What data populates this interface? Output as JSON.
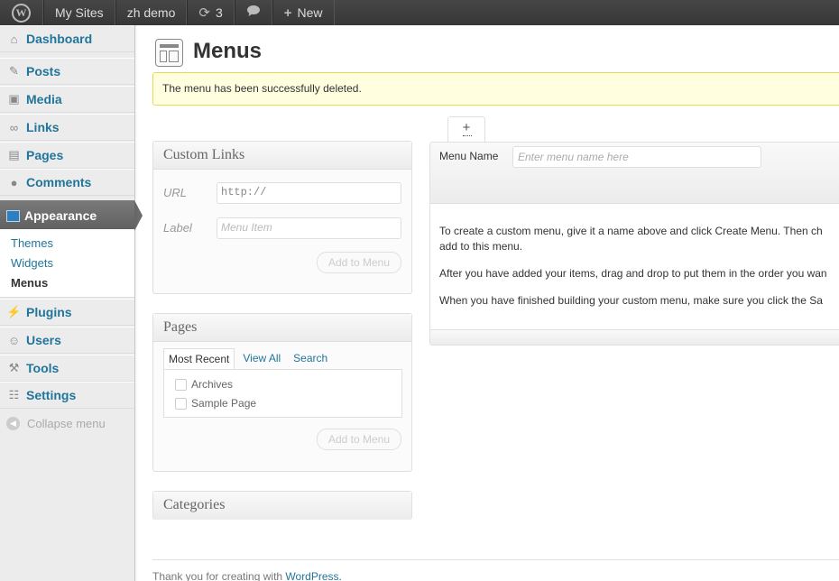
{
  "adminbar": {
    "wp_logo": "wordpress-icon",
    "items": [
      {
        "label": "My Sites"
      },
      {
        "label": "zh demo"
      },
      {
        "label": "3",
        "icon": "update-icon"
      },
      {
        "label": "",
        "icon": "comment-icon"
      },
      {
        "label": "New",
        "icon": "plus-icon"
      }
    ]
  },
  "sidebar": {
    "items": [
      {
        "label": "Dashboard",
        "icon": "home-icon"
      },
      {
        "label": "Posts",
        "icon": "pin-icon"
      },
      {
        "label": "Media",
        "icon": "media-icon"
      },
      {
        "label": "Links",
        "icon": "link-icon"
      },
      {
        "label": "Pages",
        "icon": "page-icon"
      },
      {
        "label": "Comments",
        "icon": "comment-icon"
      },
      {
        "label": "Appearance",
        "icon": "appearance-icon"
      },
      {
        "label": "Plugins",
        "icon": "plug-icon"
      },
      {
        "label": "Users",
        "icon": "users-icon"
      },
      {
        "label": "Tools",
        "icon": "tools-icon"
      },
      {
        "label": "Settings",
        "icon": "settings-icon"
      }
    ],
    "submenu": [
      "Themes",
      "Widgets",
      "Menus"
    ],
    "collapse_label": "Collapse menu"
  },
  "page": {
    "title": "Menus",
    "notice": "The menu has been successfully deleted."
  },
  "custom_links": {
    "title": "Custom Links",
    "url_label": "URL",
    "url_value": "http://",
    "label_label": "Label",
    "label_placeholder": "Menu Item",
    "add_button": "Add to Menu"
  },
  "pages_box": {
    "title": "Pages",
    "tabs": [
      "Most Recent",
      "View All",
      "Search"
    ],
    "items": [
      "Archives",
      "Sample Page"
    ],
    "add_button": "Add to Menu"
  },
  "categories_box": {
    "title": "Categories"
  },
  "menu_editor": {
    "add_tab": "+",
    "name_label": "Menu Name",
    "name_placeholder": "Enter menu name here",
    "instructions": [
      "To create a custom menu, give it a name above and click Create Menu. Then ch",
      "add to this menu.",
      "After you have added your items, drag and drop to put them in the order you wan",
      "When you have finished building your custom menu, make sure you click the Sa"
    ]
  },
  "footer": {
    "text": "Thank you for creating with ",
    "link": "WordPress."
  },
  "colors": {
    "link": "#21759b",
    "adminbar": "#464646",
    "notice_bg": "#ffffe0",
    "current_menu": "#6b6b6b"
  }
}
